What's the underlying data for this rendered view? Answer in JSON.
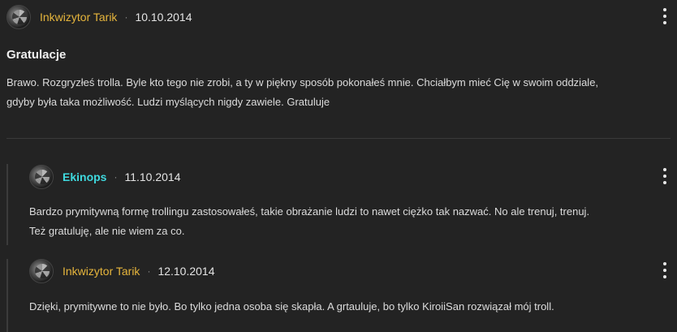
{
  "post": {
    "author": "Inkwizytor Tarik",
    "separator": "·",
    "date": "10.10.2014",
    "title": "Gratulacje",
    "body_line1": "Brawo. Rozgryzłeś trolla. Byle kto tego nie zrobi, a ty w piękny sposób pokonałeś mnie. Chciałbym mieć Cię w swoim oddziale,",
    "body_line2": "gdyby była taka możliwość. Ludzi myślących nigdy zawiele. Gratuluje"
  },
  "replies": [
    {
      "author": "Ekinops",
      "separator": "·",
      "date": "11.10.2014",
      "body_line1": "Bardzo prymitywną formę trollingu zastosowałeś, takie obrażanie ludzi to nawet ciężko tak nazwać. No ale trenuj, trenuj.",
      "body_line2": "Też gratuluję, ale nie wiem za co."
    },
    {
      "author": "Inkwizytor Tarik",
      "separator": "·",
      "date": "12.10.2014",
      "body_line1": "Dzięki, prymitywne to nie było. Bo tylko jedna osoba się skapła. A grtauluje, bo tylko KiroiiSan rozwiązał mój troll."
    }
  ],
  "colors": {
    "background": "#232323",
    "author_gold": "#e6b53c",
    "author_cyan": "#3fd9de"
  },
  "icons": {
    "menu": "kebab-menu-icon",
    "avatar": "user-avatar"
  }
}
